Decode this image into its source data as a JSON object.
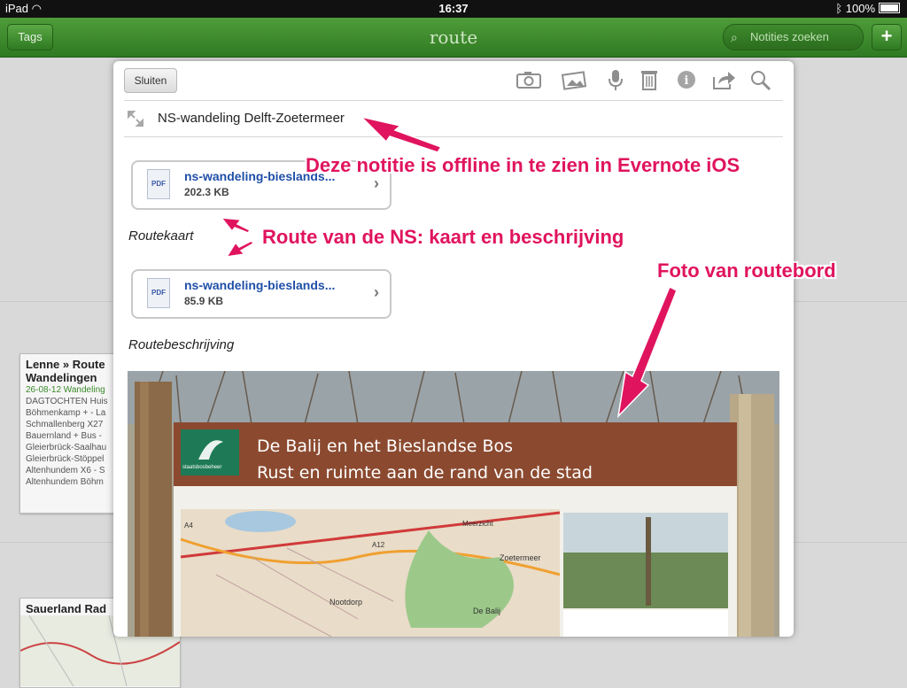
{
  "status": {
    "device": "iPad",
    "time": "16:37",
    "battery": "100%"
  },
  "nav": {
    "tags_label": "Tags",
    "title": "route",
    "search_placeholder": "Notities zoeken",
    "add_label": "+"
  },
  "bg_cards": [
    {
      "title": "Lenne » Route",
      "subtitle": "Wandelingen",
      "lines": [
        "26-08-12 Wandeling",
        "DAGTOCHTEN Huis",
        "Böhmenkamp + - La",
        "Schmallenberg X27",
        "Bauernland + Bus -",
        "Gleierbrück-Saalhau",
        "Gleierbrück-Stöppel",
        "Altenhundem X6 - S",
        "Altenhundem Böhm"
      ]
    },
    {
      "title": "Sauerland Rad"
    }
  ],
  "modal": {
    "close_label": "Sluiten",
    "note_title": "NS-wandeling Delft-Zoetermeer",
    "attachments": [
      {
        "type": "PDF",
        "name": "ns-wandeling-bieslands...",
        "size": "202.3 KB"
      },
      {
        "type": "PDF",
        "name": "ns-wandeling-bieslands...",
        "size": "85.9 KB"
      }
    ],
    "label_map": "Routekaart",
    "label_description": "Routebeschrijving",
    "photo": {
      "sign_title": "De Balij en het Bieslandse Bos",
      "sign_subtitle": "Rust en ruimte aan de rand van de stad",
      "logo_text": "staatsbosbeheer",
      "map_labels": [
        "Zoetermeer",
        "Nootdorp",
        "De Balij",
        "A12",
        "A4",
        "Meerzicht"
      ]
    }
  },
  "annotations": {
    "offline": "Deze notitie is offline in te zien in Evernote iOS",
    "route": "Route van de NS: kaart en beschrijving",
    "photo": "Foto van routebord"
  }
}
